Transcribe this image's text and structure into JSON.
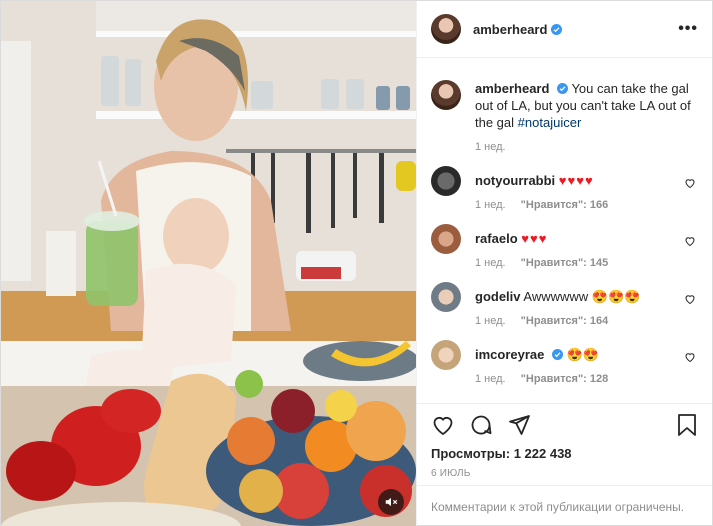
{
  "header": {
    "username": "amberheard",
    "more_label": "•••"
  },
  "caption": {
    "username": "amberheard",
    "text": "You can take the gal out of LA, but you can't take LA out of the gal",
    "hashtag": "#notajuicer",
    "time": "1 нед."
  },
  "comments": [
    {
      "username": "notyourrabbi",
      "text": "",
      "emoji": "♥♥♥♥",
      "time": "1 нед.",
      "likes": "\"Нравится\": 166"
    },
    {
      "username": "rafaelo",
      "text": "",
      "emoji": "♥♥♥",
      "time": "1 нед.",
      "likes": "\"Нравится\": 145"
    },
    {
      "username": "godeliv",
      "text": "Awwwwww",
      "emoji": "😍😍😍",
      "time": "1 нед.",
      "likes": "\"Нравится\": 164"
    },
    {
      "username": "imcoreyrae",
      "text": "",
      "emoji": "😍😍",
      "time": "1 нед.",
      "likes": "\"Нравится\": 128"
    }
  ],
  "stats": {
    "views": "Просмотры: 1 222 438",
    "date": "6 ИЮЛЬ"
  },
  "footer": {
    "notice": "Комментарии к этой публикации ограничены."
  },
  "colors": {
    "verified": "#3897f0",
    "heart": "#ed1c24",
    "hashtag": "#00376b",
    "muted": "#8e8e8e"
  }
}
